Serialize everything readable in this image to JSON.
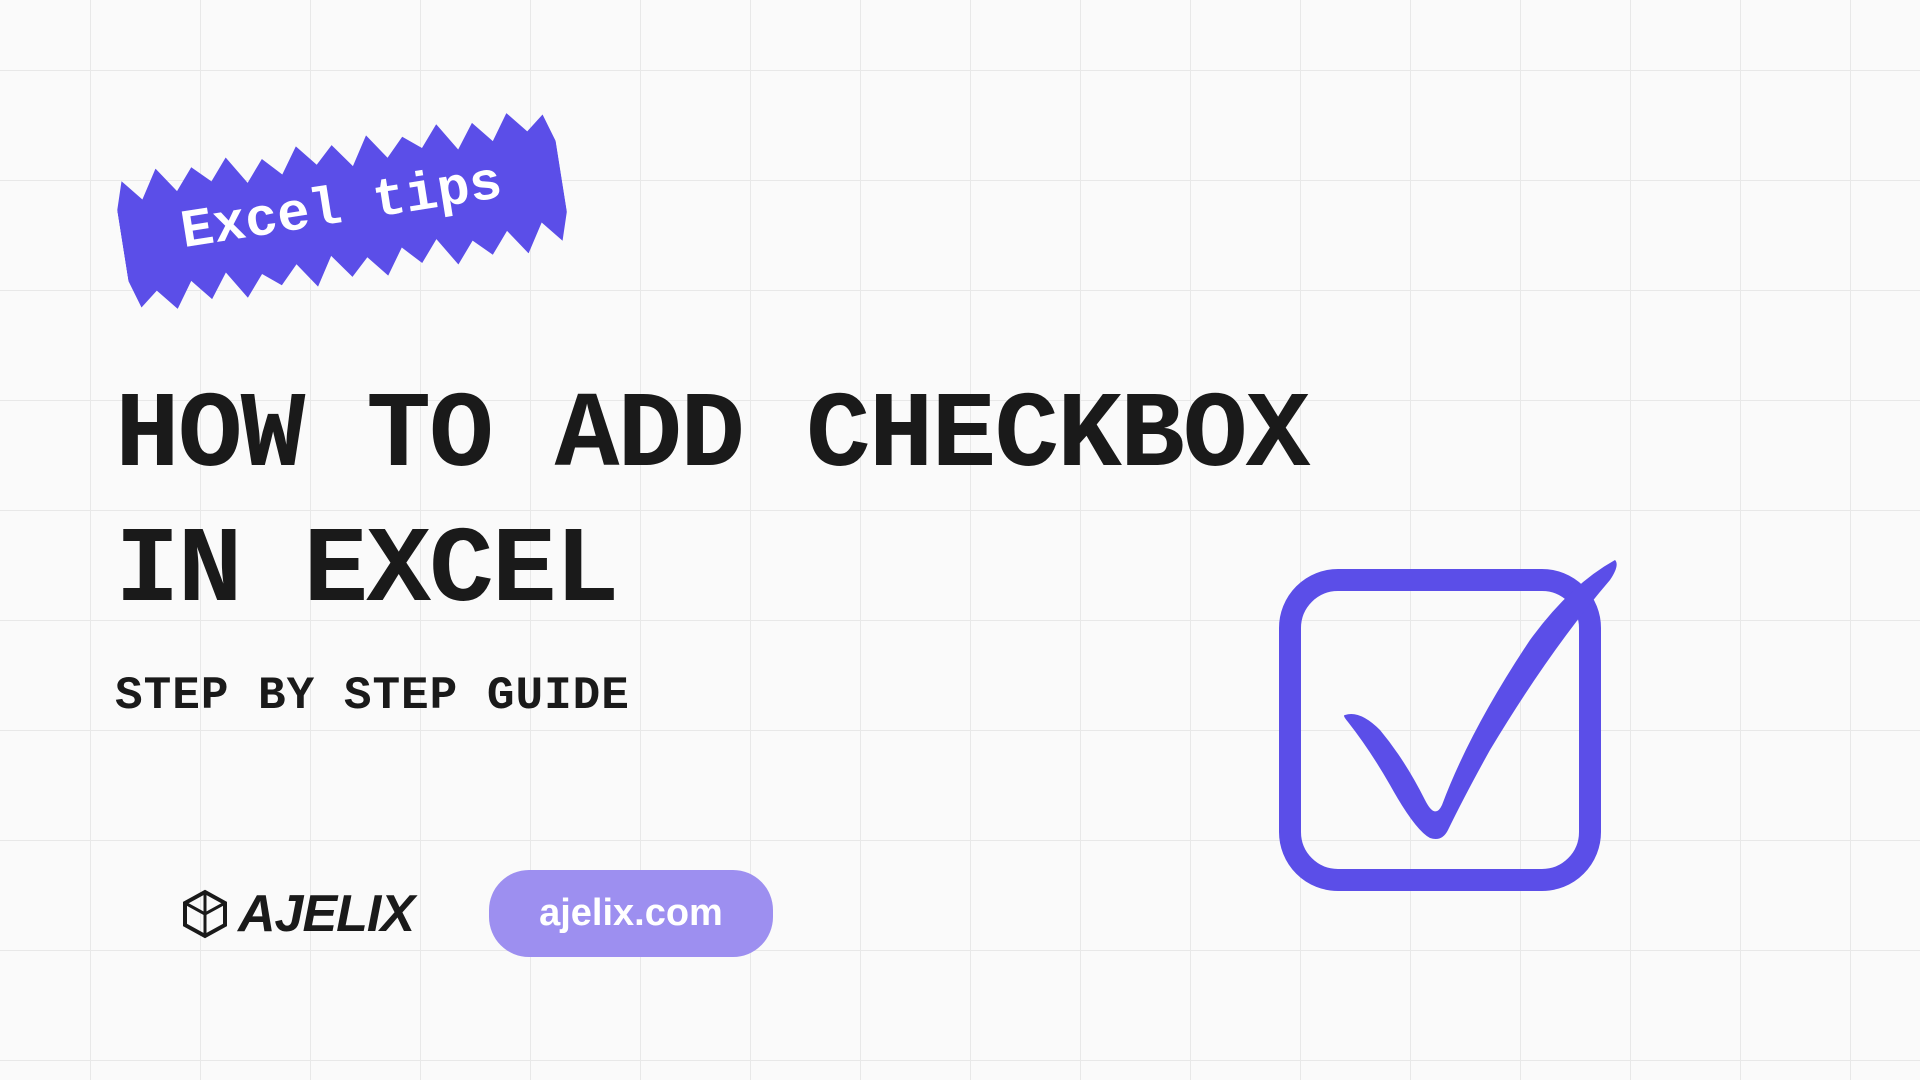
{
  "badge": {
    "text": "Excel tips"
  },
  "title": "HOW TO ADD CHECKBOX\nIN EXCEL",
  "subtitle": "STEP BY STEP GUIDE",
  "logo": {
    "text": "AJELIX"
  },
  "url": "ajelix.com",
  "colors": {
    "accent": "#5b4ee8",
    "accentLight": "#9d8ff0"
  }
}
